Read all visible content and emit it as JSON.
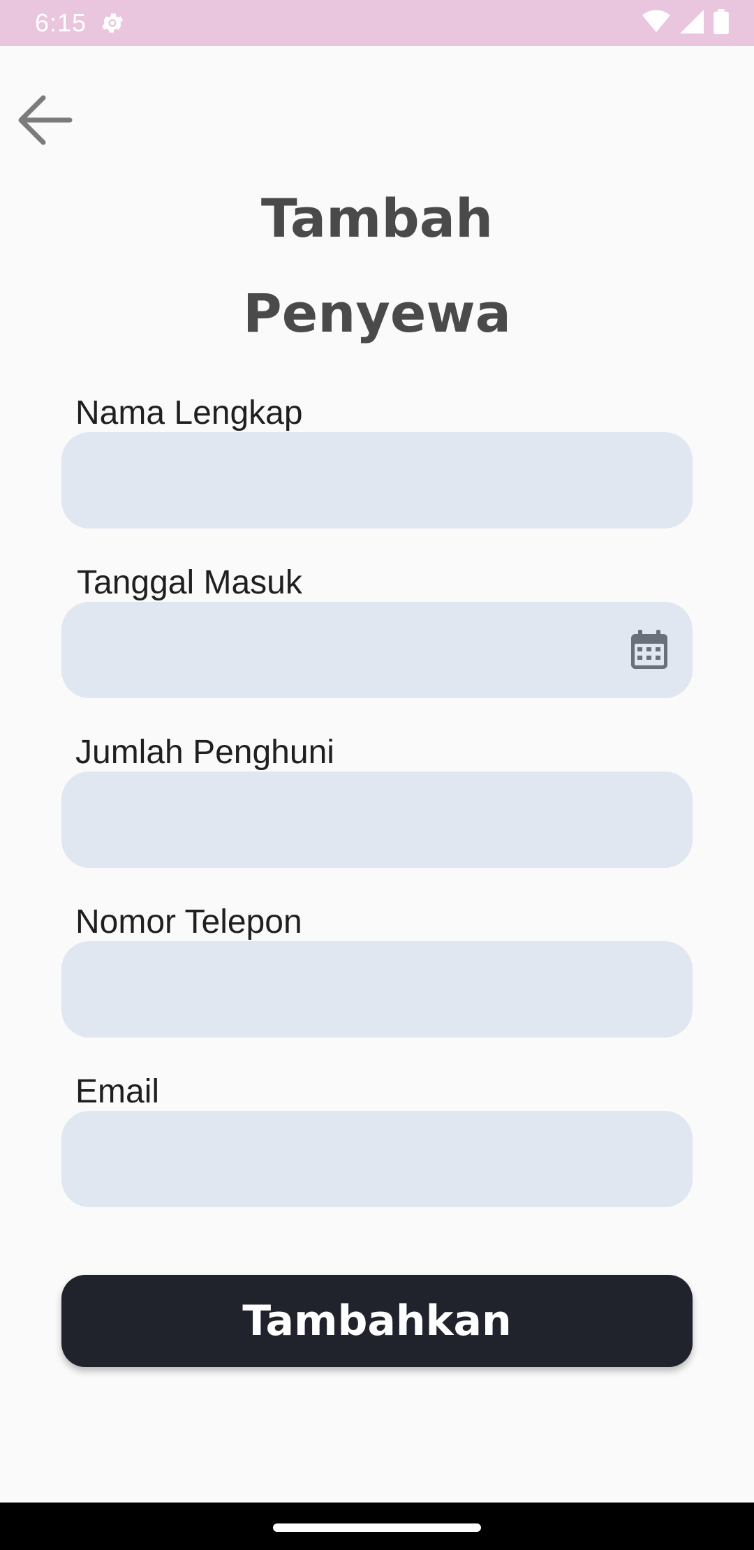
{
  "status_bar": {
    "time": "6:15",
    "icons": [
      "settings-gear-icon",
      "wifi-icon",
      "signal-icon",
      "battery-icon"
    ],
    "background_color": "#e9c5de"
  },
  "header": {
    "back_icon": "arrow-left-icon",
    "title_line1": "Tambah",
    "title_line2": "Penyewa"
  },
  "form": {
    "fields": [
      {
        "label": "Nama Lengkap",
        "value": "",
        "placeholder": ""
      },
      {
        "label": "Tanggal Masuk",
        "value": "",
        "placeholder": "",
        "trailing_icon": "calendar-icon"
      },
      {
        "label": "Jumlah Penghuni",
        "value": "",
        "placeholder": ""
      },
      {
        "label": "Nomor Telepon",
        "value": "",
        "placeholder": ""
      },
      {
        "label": "Email",
        "value": "",
        "placeholder": ""
      }
    ],
    "input_color": "#e1e7f0"
  },
  "actions": {
    "submit_label": "Tambahkan",
    "submit_color": "#20232c"
  }
}
